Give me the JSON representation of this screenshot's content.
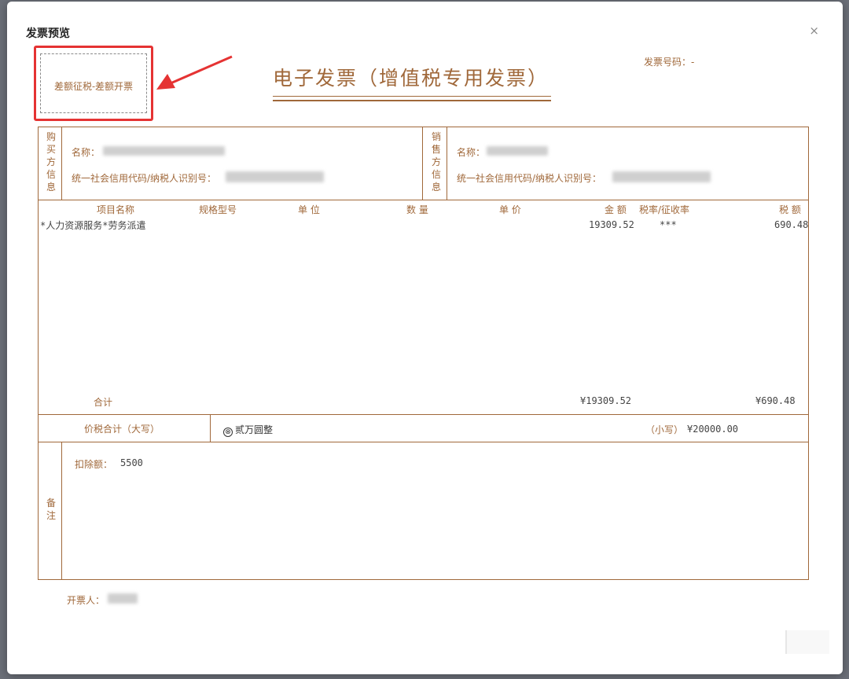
{
  "modal": {
    "title": "发票预览",
    "close": "×"
  },
  "annotation": {
    "text": "差额征税-差额开票",
    "highlight_color": "#e53333"
  },
  "header": {
    "invoice_no_label": "发票号码：",
    "invoice_no_value": "-",
    "title": "电子发票（增值税专用发票）"
  },
  "buyer": {
    "side_label": "购买方信息",
    "name_label": "名称：",
    "tax_label": "统一社会信用代码/纳税人识别号："
  },
  "seller": {
    "side_label": "销售方信息",
    "name_label": "名称：",
    "tax_label": "统一社会信用代码/纳税人识别号："
  },
  "items": {
    "columns": [
      "项目名称",
      "规格型号",
      "单 位",
      "数 量",
      "单 价",
      "金 额",
      "税率/征收率",
      "税 额"
    ],
    "rows": [
      {
        "name": "*人力资源服务*劳务派遣",
        "amount": "19309.52",
        "rate": "***",
        "tax": "690.48"
      }
    ],
    "total_label": "合计",
    "total_amount": "¥19309.52",
    "total_tax": "¥690.48"
  },
  "sum": {
    "label": "价税合计（大写）",
    "upper_icon": "⊗",
    "upper": "贰万圆整",
    "lower_label": "（小写）",
    "lower": "¥20000.00"
  },
  "remarks": {
    "side_label": "备注",
    "text_label": "扣除额：",
    "text_value": "5500"
  },
  "issuer": {
    "label": "开票人："
  },
  "colors": {
    "invoice": "#a0683a",
    "annotation": "#e53333"
  }
}
